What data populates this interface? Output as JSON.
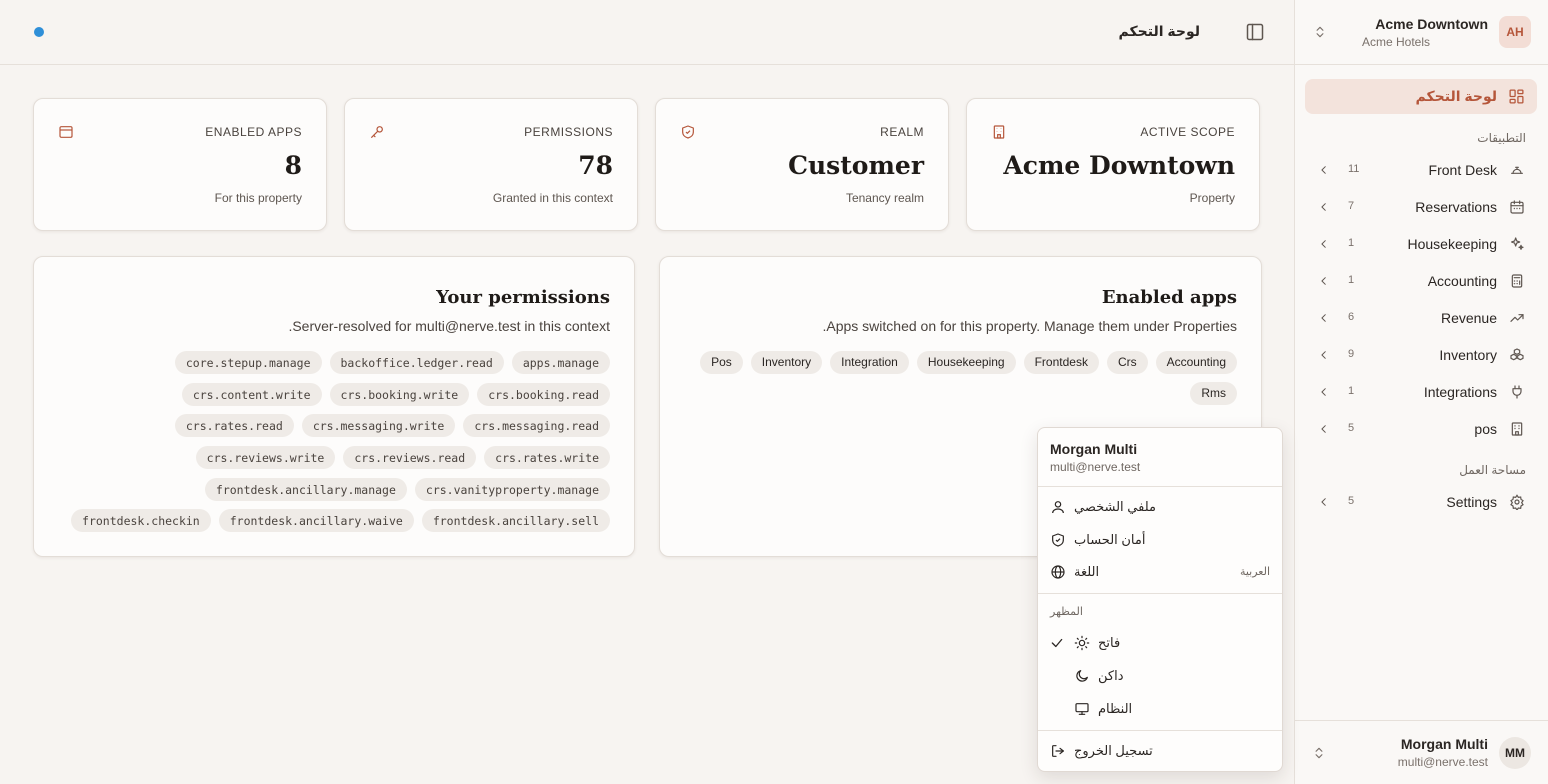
{
  "topbar": {
    "title": "لوحة التحكم",
    "status_color": "#2f8fd8"
  },
  "scope_switcher": {
    "name": "Acme Downtown",
    "org": "Acme Hotels",
    "initials": "AH"
  },
  "sidebar": {
    "dashboard_label": "لوحة التحكم",
    "apps_group_label": "التطبيقات",
    "workspace_group_label": "مساحة العمل",
    "items": [
      {
        "label": "Front Desk",
        "count": "11",
        "icon": "bell-icon"
      },
      {
        "label": "Reservations",
        "count": "7",
        "icon": "calendar-icon"
      },
      {
        "label": "Housekeeping",
        "count": "1",
        "icon": "sparkles-icon"
      },
      {
        "label": "Accounting",
        "count": "1",
        "icon": "calculator-icon"
      },
      {
        "label": "Revenue",
        "count": "6",
        "icon": "trending-up-icon"
      },
      {
        "label": "Inventory",
        "count": "9",
        "icon": "boxes-icon"
      },
      {
        "label": "Integrations",
        "count": "1",
        "icon": "plug-icon"
      },
      {
        "label": "pos",
        "count": "5",
        "icon": "building-icon"
      }
    ],
    "settings": {
      "label": "Settings",
      "count": "5",
      "icon": "gear-icon"
    }
  },
  "user": {
    "name": "Morgan Multi",
    "email": "multi@nerve.test",
    "initials": "MM"
  },
  "stats": [
    {
      "label": "ENABLED APPS",
      "value": "8",
      "sub": "For this property",
      "icon": "window-icon"
    },
    {
      "label": "PERMISSIONS",
      "value": "78",
      "sub": "Granted in this context",
      "icon": "key-icon"
    },
    {
      "label": "REALM",
      "value": "Customer",
      "sub": "Tenancy realm",
      "icon": "shield-icon"
    },
    {
      "label": "ACTIVE SCOPE",
      "value": "Acme Downtown",
      "sub": "Property",
      "icon": "building-icon"
    }
  ],
  "permissions_panel": {
    "title": "Your permissions",
    "description": ".Server-resolved for multi@nerve.test in this context",
    "chips": [
      "apps.manage",
      "backoffice.ledger.read",
      "core.stepup.manage",
      "crs.booking.read",
      "crs.booking.write",
      "crs.content.write",
      "crs.messaging.read",
      "crs.messaging.write",
      "crs.rates.read",
      "crs.rates.write",
      "crs.reviews.read",
      "crs.reviews.write",
      "crs.vanityproperty.manage",
      "frontdesk.ancillary.manage",
      "frontdesk.ancillary.sell",
      "frontdesk.ancillary.waive",
      "frontdesk.checkin"
    ]
  },
  "apps_panel": {
    "title": "Enabled apps",
    "description": ".Apps switched on for this property. Manage them under Properties",
    "chips": [
      "Accounting",
      "Crs",
      "Frontdesk",
      "Housekeeping",
      "Integration",
      "Inventory",
      "Pos",
      "Rms"
    ]
  },
  "menu": {
    "profile": "ملفي الشخصي",
    "security": "أمان الحساب",
    "language": "اللغة",
    "language_value": "العربية",
    "appearance_label": "المظهر",
    "theme_light": "فاتح",
    "theme_dark": "داكن",
    "theme_system": "النظام",
    "logout": "تسجيل الخروج"
  }
}
